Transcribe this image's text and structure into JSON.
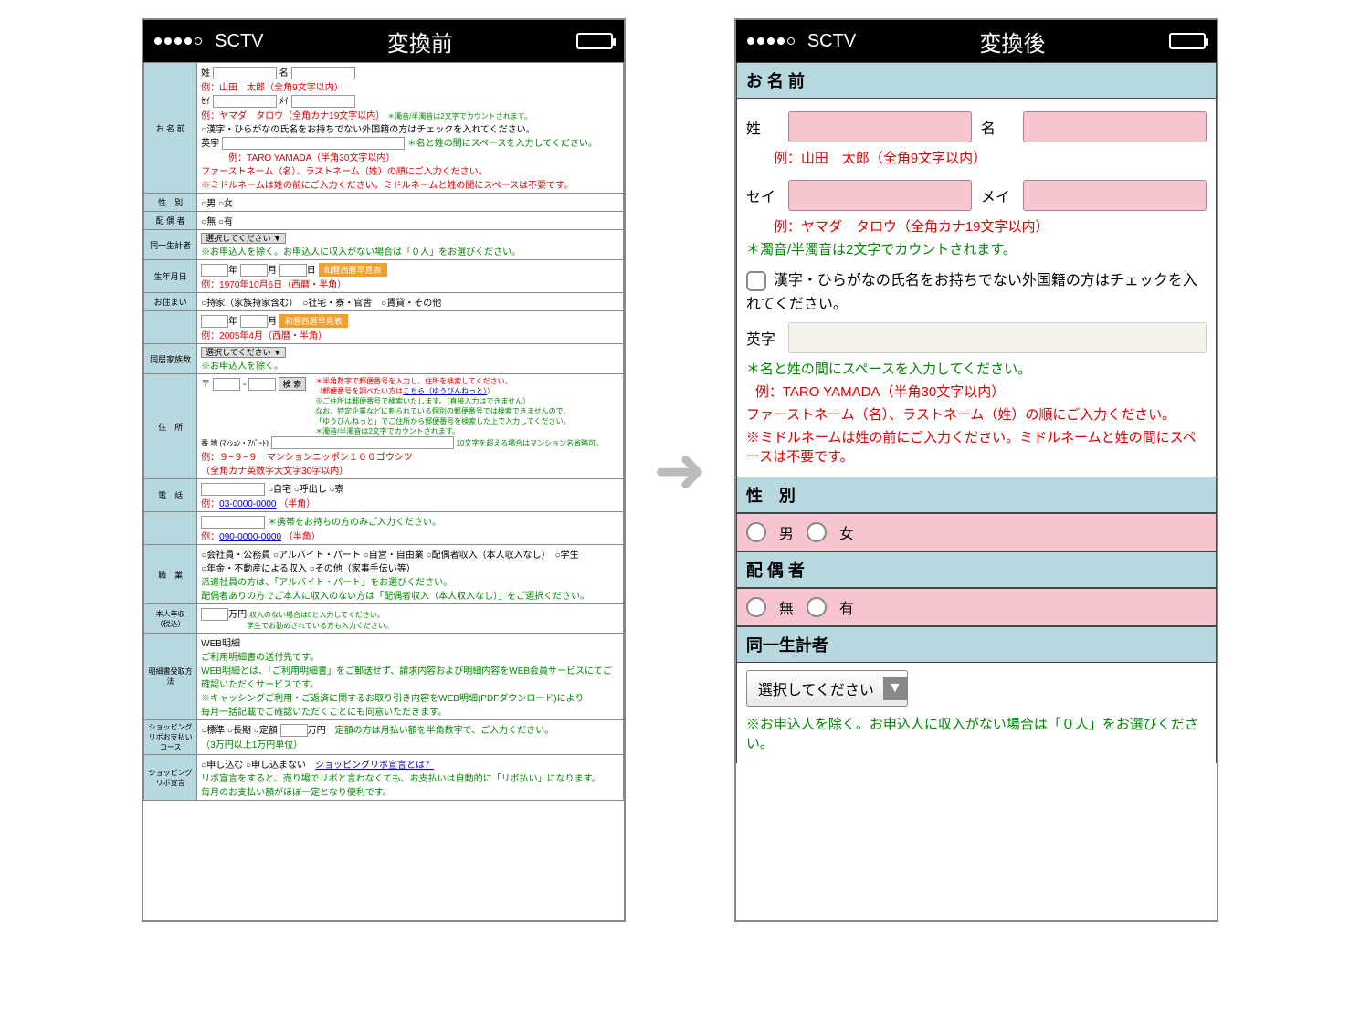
{
  "status": {
    "carrier": "SCTV",
    "left_title": "変換前",
    "right_title": "変換後"
  },
  "left": {
    "name_lbl": "お 名 前",
    "sei_lbl": "姓",
    "mei_lbl": "名",
    "name_ex": "例：山田　太郎（全角9文字以内）",
    "sei_k_lbl": "ｾｲ",
    "mei_k_lbl": "ﾒｲ",
    "kana_ex": "例：ヤマダ　タロウ（全角カナ19文字以内）",
    "kana_note": "＊濁音/半濁音は2文字でカウントされます。",
    "foreign": "○漢字・ひらがなの氏名をお持ちでない外国籍の方はチェックを入れてください。",
    "eiji_lbl": "英字",
    "eiji_note": "＊名と姓の間にスペースを入力してください。",
    "eiji_ex": "例：TARO YAMADA（半角30文字以内）",
    "eiji_order": "ファーストネーム（名）、ラストネーム（姓）の順にご入力ください。",
    "eiji_mid": "※ミドルネームは姓の前にご入力ください。ミドルネームと姓の間にスペースは不要です。",
    "sex_lbl": "性　別",
    "sex_m": "○男",
    "sex_f": "○女",
    "spouse_lbl": "配 偶 者",
    "sp_n": "○無",
    "sp_y": "○有",
    "house_lbl": "同一生計者",
    "house_sel": "選択してください ▼",
    "house_note": "※お申込人を除く。お申込人に収入がない場合は「０人」をお選びください。",
    "birth_lbl": "生年月日",
    "y": "年",
    "m": "月",
    "d": "日",
    "birth_ex": "例：1970年10月6日（西暦・半角）",
    "cal": "和暦西暦早見表",
    "home_lbl": "お住まい",
    "home_opts": "○持家（家族持家含む）　○社宅・寮・官舎　○賃貸・その他",
    "home_ex": "例：2005年4月（西暦・半角）",
    "fam_lbl": "同居家族数",
    "fam_sel": "選択してください ▼",
    "fam_note": "※お申込人を除く。",
    "addr_lbl": "住　所",
    "zip": "〒",
    "search": "検 索",
    "addr_n1": "＊半角数字で郵便番号を入力し、住所を検索してください。",
    "addr_n2": "（郵便番号を調べたい方は",
    "addr_link": "こちら（ゆうびんねっと）",
    "addr_n2b": "）",
    "addr_n3": "※ご住所は郵便番号で検索いたします。（直接入力はできません）",
    "addr_n4": "なお、特定企業などに割られている個別の郵便番号では検索できませんので、",
    "addr_n5": "「ゆうびんねっと」でご住所から郵便番号を検索した上で入力してください。",
    "addr_n6": "＊濁音/半濁音は2文字でカウントされます。",
    "addr_bldg": "番 地\n(ﾏﾝｼｮﾝ・ｱﾊﾟｰﾄ)",
    "addr_note30": "10文字を超える場合はマンション名省略可。",
    "addr_ex": "例：９−９−９　マンションニッポン１００ゴウシツ",
    "addr_ex2": "（全角カナ英数字大文字30字以内）",
    "tel_lbl": "電　話",
    "tel_opts": "○自宅 ○呼出し ○寮",
    "tel_ex": "例：",
    "tel_num": "03-0000-0000",
    "tel_han": "（半角）",
    "mob_note": "＊携帯をお持ちの方のみご入力ください。",
    "mob_ex": "例：",
    "mob_num": "090-0000-0000",
    "occ_lbl": "職　業",
    "occ1": "○会社員・公務員 ○アルバイト・パート ○自営・自由業 ○配偶者収入（本人収入なし）　○学生",
    "occ2": "○年金・不動産による収入 ○その他（家事手伝い等）",
    "occ_n1": "派遣社員の方は、「アルバイト・パート」をお選びください。",
    "occ_n2": "配偶者ありの方でご本人に収入のない方は「配偶者収入（本人収入なし）」をご選択ください。",
    "inc_lbl": "本人年収\n（税込）",
    "inc_unit": "万円",
    "inc_n1": "収入のない場合は0と入力してください。",
    "inc_n2": "学生でお勤めされている方も入力ください。",
    "web_lbl": "明細書受取方法",
    "web_t": "WEB明細",
    "web_n1": "ご利用明細書の送付先です。",
    "web_n2": "WEB明細とは、「ご利用明細書」をご郵送せず、請求内容および明細内容をWEB会員サービスにてご確認いただくサービスです。",
    "web_n3": "※キャッシングご利用・ご返済に関するお取り引き内容をWEB明細(PDFダウンロード)により",
    "web_n4": "毎月一括記載でご確認いただくことにも同意いただきます。",
    "pay_lbl": "ショッピングリボお支払いコース",
    "pay_opts": "○標準 ○長期 ○定額",
    "pay_unit": "万円",
    "pay_note": "定額の方は月払い額を半角数字で、ご入力ください。",
    "pay_note2": "（3万円以上1万円単位）",
    "rev_lbl": "ショッピングリボ宣言",
    "rev_opts": "○申し込む ○申し込まない　",
    "rev_link": "ショッピングリボ宣言とは？",
    "rev_n1": "リボ宣言をすると、売り場でリボと言わなくても、お支払いは自動的に「リボ払い」になります。",
    "rev_n2": "毎月のお支払い額がほぼ一定となり便利です。"
  },
  "right": {
    "name_head": "お 名 前",
    "sei": "姓",
    "mei": "名",
    "name_ex": "例：山田　太郎（全角9文字以内）",
    "sei_k": "セイ",
    "mei_k": "メイ",
    "kana_ex": "例：ヤマダ　タロウ（全角カナ19文字以内）",
    "kana_note": "＊濁音/半濁音は2文字でカウントされます。",
    "foreign": "漢字・ひらがなの氏名をお持ちでない外国籍の方はチェックを入れてください。",
    "eiji": "英字",
    "eiji_note": "＊名と姓の間にスペースを入力してください。",
    "eiji_ex": "例：TARO YAMADA（半角30文字以内）",
    "eiji_order": "ファーストネーム（名）、ラストネーム（姓）の順にご入力ください。",
    "eiji_mid": "※ミドルネームは姓の前にご入力ください。ミドルネームと姓の間にスペースは不要です。",
    "sex_head": "性　別",
    "m": "男",
    "f": "女",
    "spouse_head": "配 偶 者",
    "n": "無",
    "y": "有",
    "house_head": "同一生計者",
    "sel": "選択してください",
    "house_note": "※お申込人を除く。お申込人に収入がない場合は「０人」をお選びください。"
  }
}
